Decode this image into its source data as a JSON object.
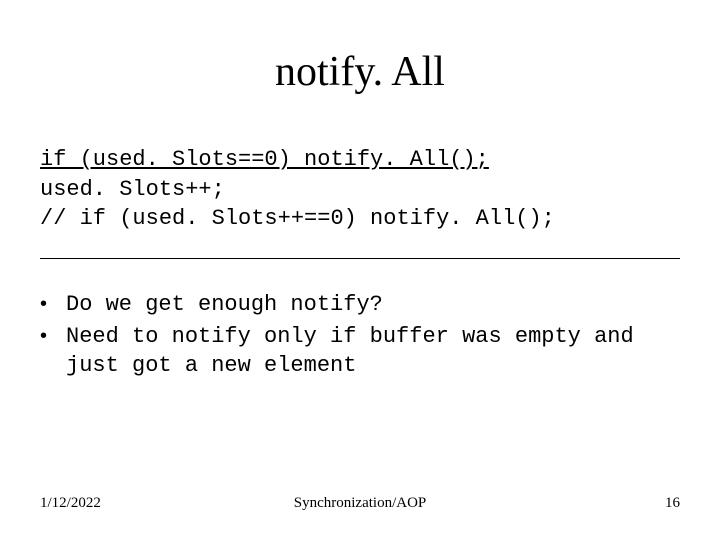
{
  "title": "notify. All",
  "code": {
    "line1": "if (used. Slots==0) notify. All();",
    "line2": "used. Slots++;",
    "line3": "// if (used. Slots++==0) notify. All();"
  },
  "bullets": [
    "Do we get enough notify?",
    "Need to notify only if buffer was empty and just got a new element"
  ],
  "footer": {
    "date": "1/12/2022",
    "center": "Synchronization/AOP",
    "page": "16"
  }
}
